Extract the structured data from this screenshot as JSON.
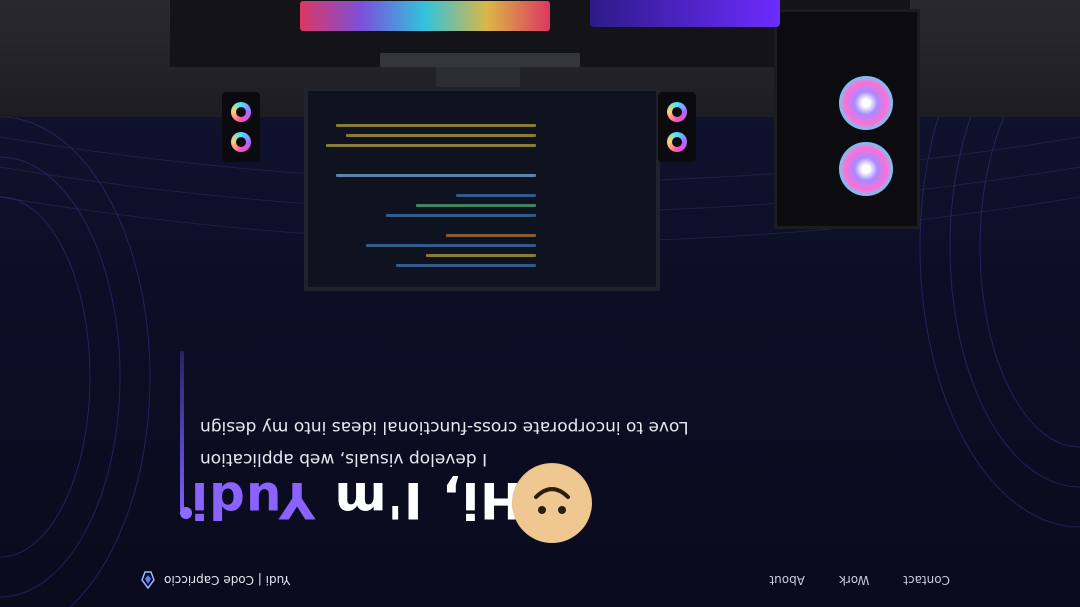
{
  "brand": {
    "name": "Yudi | Code Capriccio"
  },
  "nav": {
    "links": [
      "About",
      "Work",
      "Contact"
    ]
  },
  "hero": {
    "greeting": "Hi, I'm ",
    "name": "Yudi",
    "line1": "I develop visuals, web application",
    "line2": "Love to incorporate cross-functional ideas into my design"
  },
  "colors": {
    "accent": "#8a63ff",
    "background": "#0b0c1f"
  }
}
